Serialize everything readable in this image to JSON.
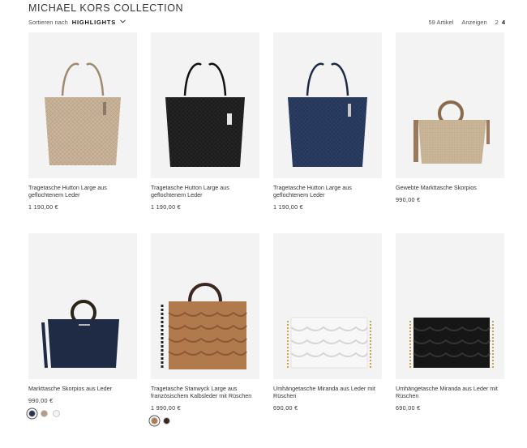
{
  "page": {
    "title": "MICHAEL KORS COLLECTION"
  },
  "toolbar": {
    "sort_label": "Sortieren nach",
    "sort_value": "HIGHLIGHTS",
    "item_count": "59 Artikel",
    "show_label": "Anzeigen",
    "show_options": [
      "2",
      "4"
    ],
    "show_active": "4"
  },
  "products": [
    {
      "name": "Tragetasche Hutton Large aus geflochtenem Leder",
      "price": "1 190,00 €",
      "color": "#c9b49a",
      "swatches": []
    },
    {
      "name": "Tragetasche Hutton Large aus geflochtenem Leder",
      "price": "1 190,00 €",
      "color": "#1c1c1c",
      "swatches": []
    },
    {
      "name": "Tragetasche Hutton Large aus geflochtenem Leder",
      "price": "1 190,00 €",
      "color": "#2b3d63",
      "swatches": []
    },
    {
      "name": "Gewebte Markttasche Skorpios",
      "price": "990,00 €",
      "color": "#c9b597",
      "swatches": []
    },
    {
      "name": "Markttasche Skorpios aus Leder",
      "price": "990,00 €",
      "color": "#1f2a44",
      "swatches": [
        "#2a3350",
        "#b49c86",
        "#f4f4f4"
      ]
    },
    {
      "name": "Tragetasche Stanwyck Large aus französischem Kalbsleder mit Rüschen",
      "price": "1 990,00 €",
      "color": "#b07a4c",
      "swatches": [
        "#b07a4c",
        "#3b2620"
      ]
    },
    {
      "name": "Umhängetasche Miranda aus Leder mit Rüschen",
      "price": "690,00 €",
      "color": "#f7f7f7",
      "swatches": []
    },
    {
      "name": "Umhängetasche Miranda aus Leder mit Rüschen",
      "price": "690,00 €",
      "color": "#161616",
      "swatches": []
    }
  ]
}
